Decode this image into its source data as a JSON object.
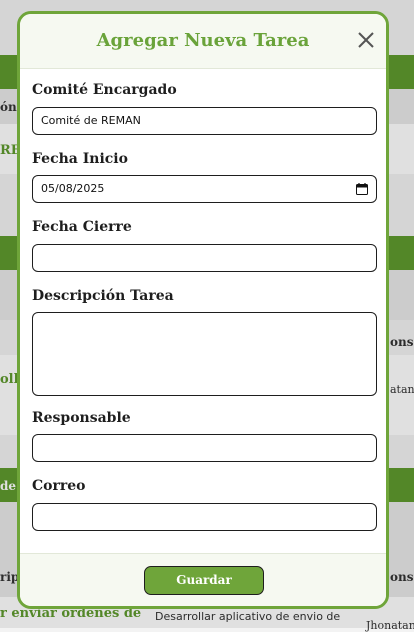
{
  "background": {
    "row1_label": "ón",
    "row2_label": "RE",
    "row3_label": "olla",
    "col_right_1": "onsab",
    "col_right_2": "atan",
    "row4_label": "de c",
    "col_left_header": "ripc",
    "col_right_header": "onsab",
    "bottom_left": "r enviar ordenes de",
    "bottom_mid": "Desarrollar aplicativo de envio de",
    "bottom_right": "Jhonatan"
  },
  "modal": {
    "title": "Agregar Nueva Tarea",
    "fields": {
      "committee_label": "Comité Encargado",
      "committee_value": "Comité de REMAN",
      "start_label": "Fecha Inicio",
      "start_value": "05/08/2025",
      "end_label": "Fecha Cierre",
      "end_value": "",
      "description_label": "Descripción Tarea",
      "description_value": "",
      "responsible_label": "Responsable",
      "responsible_value": "",
      "email_label": "Correo",
      "email_value": ""
    },
    "save_label": "Guardar"
  },
  "colors": {
    "accent": "#6fa53a",
    "title": "#6aa33a",
    "bg_band": "#5f9a2e"
  }
}
